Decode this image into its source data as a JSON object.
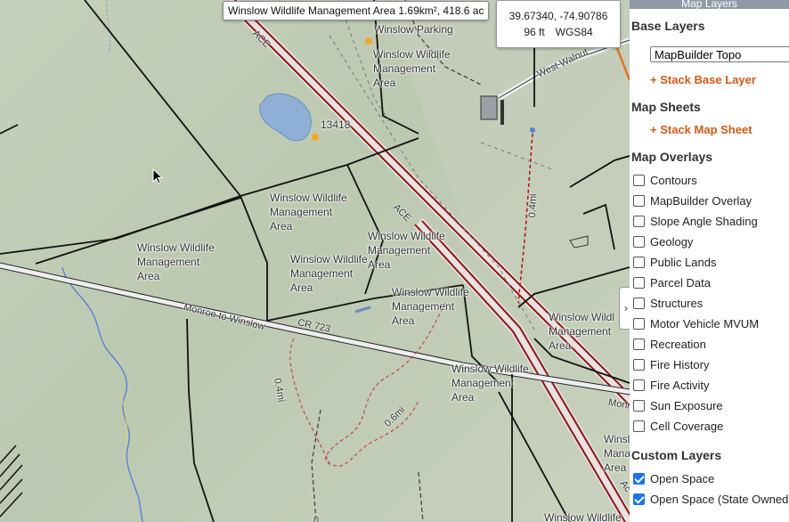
{
  "tooltip": "Winslow Wildlife Management Area 1.69km², 418.6 ac",
  "coords": {
    "latlon": "39.67340, -74.90786",
    "elevation": "96 ft",
    "datum": "WGS84"
  },
  "toggle_icon": "›",
  "panel": {
    "header": "Map Layers",
    "base_layers_title": "Base Layers",
    "base_layer_selected": "MapBuilder Topo",
    "stack_base_layer": "+ Stack Base Layer",
    "map_sheets_title": "Map Sheets",
    "stack_map_sheet": "+ Stack Map Sheet",
    "overlays_title": "Map Overlays",
    "overlays": [
      {
        "label": "Contours",
        "checked": false
      },
      {
        "label": "MapBuilder Overlay",
        "checked": false
      },
      {
        "label": "Slope Angle Shading",
        "checked": false
      },
      {
        "label": "Geology",
        "checked": false
      },
      {
        "label": "Public Lands",
        "checked": false
      },
      {
        "label": "Parcel Data",
        "checked": false
      },
      {
        "label": "Structures",
        "checked": false
      },
      {
        "label": "Motor Vehicle MVUM",
        "checked": false
      },
      {
        "label": "Recreation",
        "checked": false
      },
      {
        "label": "Fire History",
        "checked": false
      },
      {
        "label": "Fire Activity",
        "checked": false
      },
      {
        "label": "Sun Exposure",
        "checked": false
      },
      {
        "label": "Cell Coverage",
        "checked": false
      }
    ],
    "custom_title": "Custom Layers",
    "custom": [
      {
        "label": "Open Space",
        "checked": true
      },
      {
        "label": "Open Space (State Owned)",
        "checked": true
      }
    ]
  },
  "map": {
    "area_labels": [
      "Winslow Wildlife\nManagement\nArea",
      "Winslow Wildlife\nManagement\nArea",
      "Winslow Wildlife\nManagement\nArea",
      "Winslow Wildlife\nManagement\nArea",
      "Winslow Wildlife\nManagement\nArea",
      "Winslow Wildlife\nManagement\nArea",
      "Winslow Wildlife\nManagement\nArea",
      "Winslow Wildl\nManagement\nArea",
      "Winsl\nMana\nArea",
      "Winslow Wildlife"
    ],
    "poi_parking": "Winslow Parking",
    "poi_elev": "13418",
    "road_ace_1": "ACE",
    "road_ace_2": "ACE",
    "road_ace_3": "Ac",
    "road_monroe": "Monroe to Winslow",
    "road_cr723": "CR 723",
    "road_west_walnut": "West Walnut",
    "road_monr": "Monr",
    "dist_1": "0.4mi",
    "dist_2": "0.4mi",
    "dist_3": "0.6mi",
    "dist_4": "0."
  }
}
